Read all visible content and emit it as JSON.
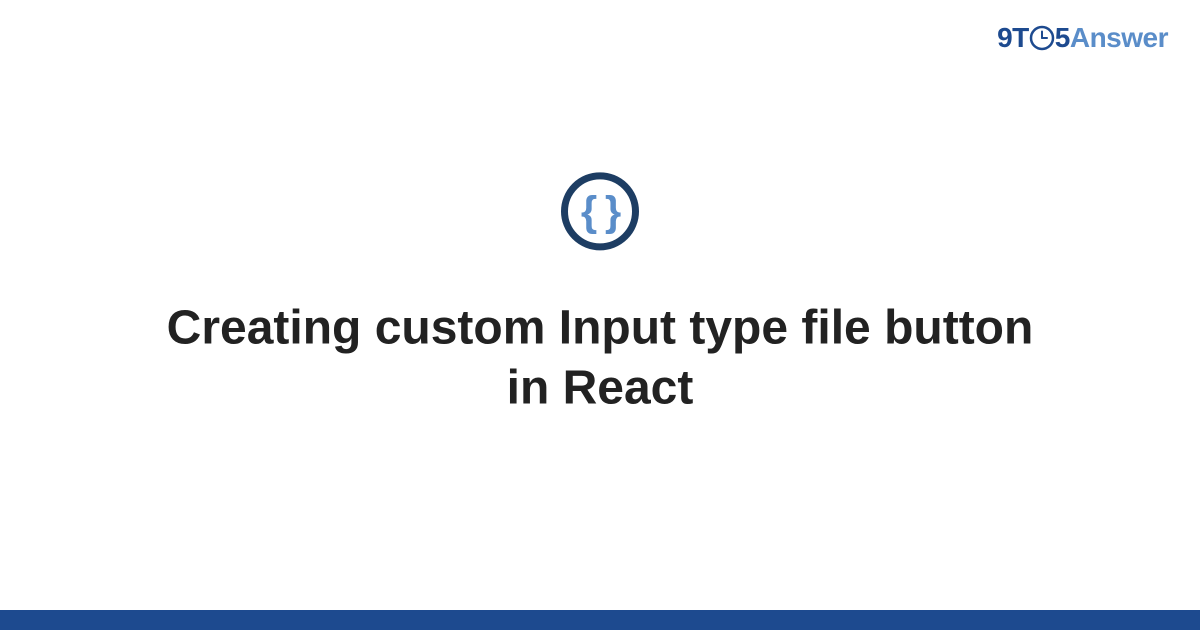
{
  "logo": {
    "part1": "9T",
    "part2": "5",
    "part3": "Answer"
  },
  "icon": {
    "content": "{ }"
  },
  "title": "Creating custom Input type file button in React",
  "colors": {
    "brand_dark": "#1d4a8f",
    "brand_light": "#5a8dc9",
    "icon_ring": "#1d3d63",
    "text": "#222222"
  }
}
